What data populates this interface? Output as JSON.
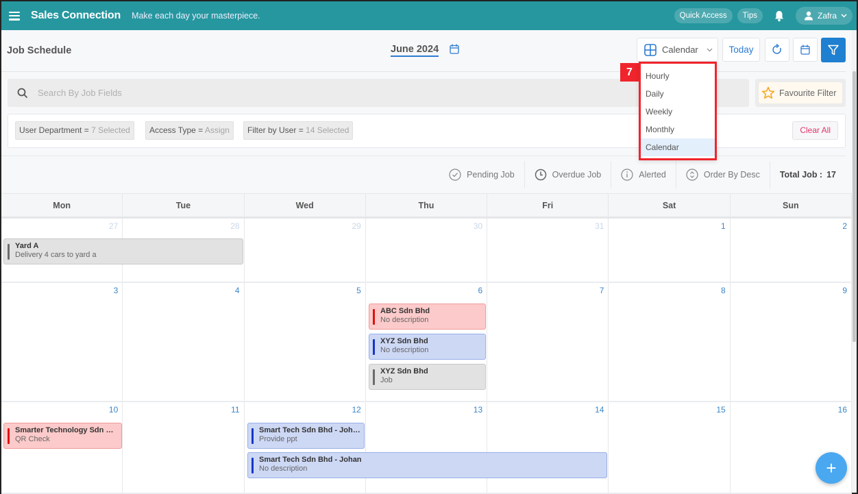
{
  "topbar": {
    "brand": "Sales Connection",
    "tagline": "Make each day your masterpiece.",
    "quick_access": "Quick Access",
    "tips": "Tips",
    "user_name": "Zafra"
  },
  "header": {
    "title": "Job Schedule",
    "month": "June 2024",
    "view_selected": "Calendar",
    "today_label": "Today"
  },
  "view_menu": {
    "badge": "7",
    "items": [
      "Hourly",
      "Daily",
      "Weekly",
      "Monthly",
      "Calendar"
    ],
    "active": "Calendar"
  },
  "search": {
    "placeholder": "Search By Job Fields",
    "value": ""
  },
  "favourite_filter": "Favourite Filter",
  "filters": {
    "chips": [
      {
        "label": "User Department",
        "op": "=",
        "value": "7 Selected"
      },
      {
        "label": "Access Type",
        "op": "=",
        "value": "Assign"
      },
      {
        "label": "Filter by User",
        "op": "=",
        "value": "14 Selected"
      }
    ],
    "clear_all": "Clear All"
  },
  "legend": {
    "pending": "Pending Job",
    "overdue": "Overdue Job",
    "alerted": "Alerted",
    "order": "Order By Desc",
    "total_label": "Total Job :",
    "total_value": "17"
  },
  "calendar": {
    "days_of_week": [
      "Mon",
      "Tue",
      "Wed",
      "Thu",
      "Fri",
      "Sat",
      "Sun"
    ],
    "weeks": [
      [
        "27",
        "28",
        "29",
        "30",
        "31",
        "1",
        "2"
      ],
      [
        "3",
        "4",
        "5",
        "6",
        "7",
        "8",
        "9"
      ],
      [
        "10",
        "11",
        "12",
        "13",
        "14",
        "15",
        "16"
      ]
    ],
    "events": [
      {
        "title": "Yard A",
        "desc": "Delivery 4 cars to yard a",
        "color": "gray"
      },
      {
        "title": "ABC Sdn Bhd",
        "desc": "No description",
        "color": "red"
      },
      {
        "title": "XYZ Sdn Bhd",
        "desc": "No description",
        "color": "blue"
      },
      {
        "title": "XYZ Sdn Bhd",
        "desc": "Job",
        "color": "gray"
      },
      {
        "title": "Smarter Technology Sdn Bh...",
        "desc": "QR Check",
        "color": "red"
      },
      {
        "title": "Smart Tech Sdn Bhd - Johan",
        "desc": "Provide ppt",
        "color": "blue"
      },
      {
        "title": "Smart Tech Sdn Bhd - Johan",
        "desc": "No description",
        "color": "blue"
      }
    ]
  },
  "fab_label": "+"
}
